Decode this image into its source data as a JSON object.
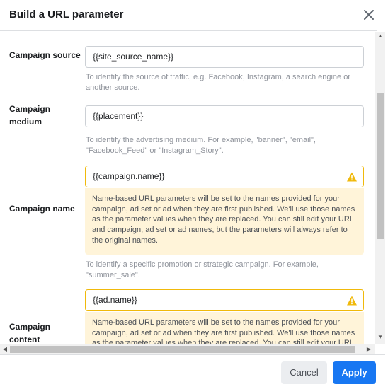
{
  "dialog": {
    "title": "Build a URL parameter",
    "close_icon": "close-icon"
  },
  "fields": {
    "campaign_source": {
      "label": "Campaign source",
      "value": "{{site_source_name}}",
      "help": "To identify the source of traffic, e.g. Facebook, Instagram, a search engine or another source."
    },
    "campaign_medium": {
      "label": "Campaign medium",
      "value": "{{placement}}",
      "help": "To identify the advertising medium. For example, \"banner\", \"email\", \"Facebook_Feed\" or \"Instagram_Story\"."
    },
    "campaign_name": {
      "label": "Campaign name",
      "value": "{{campaign.name}}",
      "warning": "Name-based URL parameters will be set to the names provided for your campaign, ad set or ad when they are first published. We'll use those names as the parameter values when they are replaced. You can still edit your URL and campaign, ad set or ad names, but the parameters will always refer to the original names.",
      "help": "To identify a specific promotion or strategic campaign. For example, \"summer_sale\"."
    },
    "campaign_content": {
      "label": "Campaign content",
      "value": "{{ad.name}}",
      "warning": "Name-based URL parameters will be set to the names provided for your campaign, ad set or ad when they are first published. We'll use those names as the parameter values when they are replaced. You can still edit your URL and campaign, ad set or ad names, but the parameters will always refer to the original names."
    }
  },
  "footer": {
    "cancel_label": "Cancel",
    "apply_label": "Apply"
  },
  "colors": {
    "accent": "#1877f2",
    "warning_border": "#f0b90b",
    "warning_bg": "#fff4d9"
  }
}
